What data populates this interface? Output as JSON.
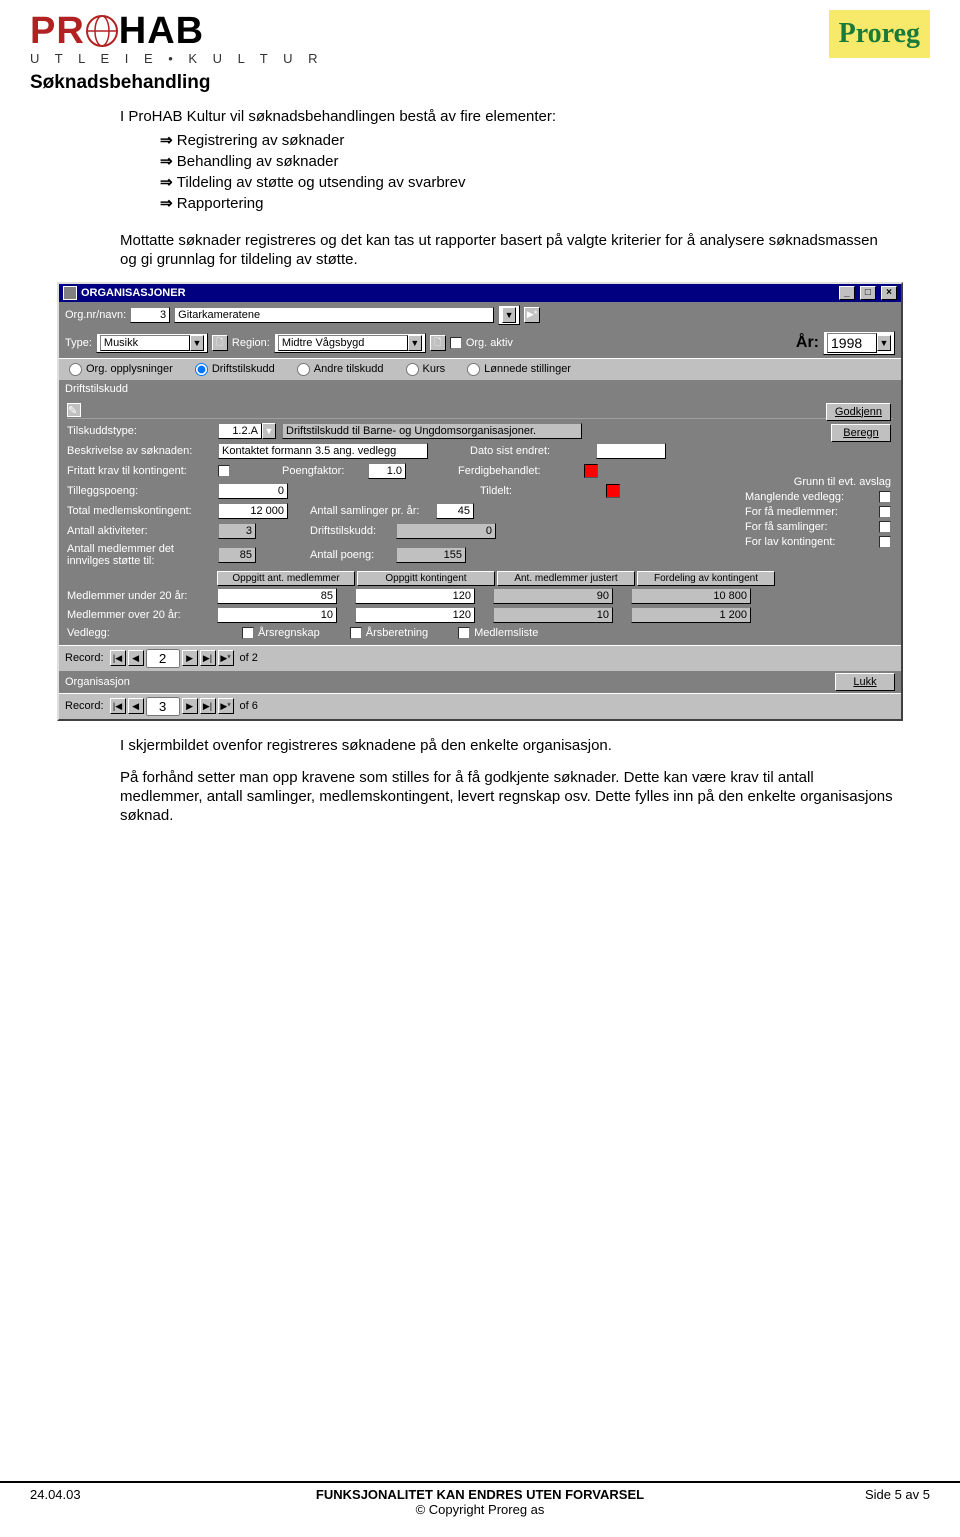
{
  "logos": {
    "prohab_p": "PR",
    "prohab_rest": "HAB",
    "prohab_sub": "U T L E I E   •   K U L T U R",
    "proreg": "Proreg"
  },
  "doc": {
    "section_h": "Søknadsbehandling",
    "intro": "I ProHAB Kultur vil søknadsbehandlingen bestå av fire elementer:",
    "bullets": [
      "Registrering av søknader",
      "Behandling av søknader",
      "Tildeling av støtte og utsending av svarbrev",
      "Rapportering"
    ],
    "para1": "Mottatte søknader registreres og det kan tas ut rapporter basert på valgte kriterier for å analysere søknadsmassen og gi grunnlag for tildeling av støtte.",
    "para2": "I skjermbildet ovenfor registreres søknadene på den enkelte organisasjon.",
    "para3": "På forhånd setter man opp kravene som stilles for å få godkjente søknader. Dette kan være krav til antall medlemmer, antall samlinger, medlemskontingent, levert regnskap osv. Dette fylles inn på den enkelte organisasjons søknad."
  },
  "win": {
    "title": "ORGANISASJONER",
    "row1": {
      "org_label": "Org.nr/navn:",
      "org_nr": "3",
      "org_navn": "Gitarkameratene"
    },
    "row2": {
      "type_l": "Type:",
      "type_v": "Musikk",
      "region_l": "Region:",
      "region_v": "Midtre Vågsbygd",
      "aktiv_l": "Org. aktiv",
      "year_l": "År:",
      "year_v": "1998"
    },
    "tabs": {
      "opp": "Org. opplysninger",
      "drift": "Driftstilskudd",
      "andre": "Andre tilskudd",
      "kurs": "Kurs",
      "lonn": "Lønnede stillinger"
    },
    "subhdr": "Driftstilskudd",
    "panel": {
      "tilskuddstype_l": "Tilskuddstype:",
      "tilskuddstype_v": "1.2.A",
      "tilskuddstype_desc": "Driftstilskudd til Barne- og Ungdomsorganisasjoner.",
      "beskrivelse_l": "Beskrivelse av søknaden:",
      "beskrivelse_v": "Kontaktet formann 3.5 ang. vedlegg",
      "dato_l": "Dato sist endret:",
      "fritatt_l": "Fritatt krav til kontingent:",
      "poengfaktor_l": "Poengfaktor:",
      "poengfaktor_v": "1.0",
      "ferdig_l": "Ferdigbehandlet:",
      "tillegg_l": "Tilleggspoeng:",
      "tillegg_v": "0",
      "tildelt_l": "Tildelt:",
      "total_l": "Total medlemskontingent:",
      "total_v": "12 000",
      "samlinger_l": "Antall samlinger pr. år:",
      "samlinger_v": "45",
      "akt_l": "Antall aktiviteter:",
      "akt_v": "3",
      "drift_l": "Driftstilskudd:",
      "drift_v": "0",
      "medl_l": "Antall medlemmer det innvilges støtte til:",
      "medl_v": "85",
      "poeng_l": "Antall poeng:",
      "poeng_v": "155",
      "godkjenn": "Godkjenn",
      "beregn": "Beregn",
      "grunn_h": "Grunn til evt. avslag",
      "grunn1": "Manglende vedlegg:",
      "grunn2": "For få medlemmer:",
      "grunn3": "For få samlinger:",
      "grunn4": "For lav kontingent:",
      "ch1": "Oppgitt ant. medlemmer",
      "ch2": "Oppgitt kontingent",
      "ch3": "Ant. medlemmer justert",
      "ch4": "Fordeling av kontingent",
      "u20_l": "Medlemmer under 20 år:",
      "u20": [
        "85",
        "120",
        "90",
        "10 800"
      ],
      "o20_l": "Medlemmer over 20 år:",
      "o20": [
        "10",
        "120",
        "10",
        "1 200"
      ],
      "vedlegg_l": "Vedlegg:",
      "att1": "Årsregnskap",
      "att2": "Årsberetning",
      "att3": "Medlemsliste"
    },
    "rec1": {
      "l": "Record:",
      "v": "2",
      "of": "of  2"
    },
    "org_l": "Organisasjon",
    "lukk": "Lukk",
    "rec2": {
      "l": "Record:",
      "v": "3",
      "of": "of  6"
    }
  },
  "footer": {
    "date": "24.04.03",
    "center1": "FUNKSJONALITET KAN ENDRES UTEN FORVARSEL",
    "center2": "© Copyright Proreg as",
    "side": "Side 5 av 5"
  }
}
